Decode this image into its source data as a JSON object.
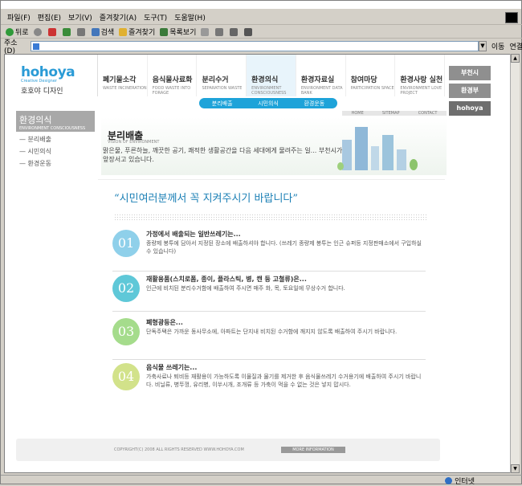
{
  "menubar": [
    "파일(F)",
    "편집(E)",
    "보기(V)",
    "즐겨찾기(A)",
    "도구(T)",
    "도움말(H)"
  ],
  "toolbar": {
    "back": "뒤로",
    "search": "검색",
    "favorites": "즐겨찾기",
    "history": "목록보기"
  },
  "address": {
    "label": "주소(D)",
    "value": "",
    "go": "이동",
    "links": "연결"
  },
  "status": {
    "text": "",
    "zone": "인터넷"
  },
  "site": {
    "logo": {
      "mark": "hohoya",
      "sub": "Creative Designer",
      "kr": "호호야 디자인"
    },
    "gnb": [
      {
        "t": "폐기물소각",
        "e": "WASTE INCINERATION"
      },
      {
        "t": "음식물사료화",
        "e": "FOOD WASTE INTO FORAGE"
      },
      {
        "t": "분리수거",
        "e": "SEPARATION WASTE"
      },
      {
        "t": "환경의식",
        "e": "ENVIRONMENT CONSCIOUSNESS"
      },
      {
        "t": "환경자료실",
        "e": "ENVIRONMENT DATA BANK"
      },
      {
        "t": "참여마당",
        "e": "PARTICIPATION SPACE"
      },
      {
        "t": "환경사랑 실천",
        "e": "ENVIRONMENT LOVE PROJECT"
      }
    ],
    "subnav": [
      "분리배출",
      "시민의식",
      "환경운동"
    ],
    "util": [
      "HOME",
      "SITEMAP",
      "CONTACT"
    ],
    "rightlinks": [
      "부천시",
      "환경부",
      "hohoya"
    ],
    "lnb": {
      "title": "환경의식",
      "sub": "ENVIRONMENT CONSCIOUSNESS",
      "items": [
        "분리배출",
        "시민의식",
        "환경운동"
      ]
    },
    "banner": {
      "title": "분리배출",
      "sub": "VISION OF ENVIRONMENT",
      "desc": "맑은물, 푸른하늘, 깨끗한 공기, 쾌적한 생활공간을 다음 세대에게 물려주는 일... 부천시가 앞장서고 있습니다."
    },
    "slogan": "“시민여러분께서 꼭 지켜주시기 바랍니다”",
    "steps": [
      {
        "num": "01",
        "h": "가정에서 배출되는 일반쓰레기는...",
        "p": "종량제 봉투에 담아서 지정된 장소에 배출하셔야 합니다. (쓰레기 종량제 봉투는 인근 슈퍼등 지정판매소에서 구입하실 수 있습니다)",
        "color": "#8fd0ea"
      },
      {
        "num": "02",
        "h": "재활용품(스치로폼, 종이, 플라스틱, 병, 캔 등 고철류)은...",
        "p": "인근에 비치된 분리수거함에 배출하여 주시면 매주 화, 목, 토요일에 무상수거 합니다.",
        "color": "#5fc8d8"
      },
      {
        "num": "03",
        "h": "폐형광등은...",
        "p": "단독주택은 가까운 동사무소에, 아파트는 단지내 비치된 수거함에 깨지지 않도록 배출하여 주시기 바랍니다.",
        "color": "#a5dc8c"
      },
      {
        "num": "04",
        "h": "음식물 쓰레기는...",
        "p": "가축사료나 퇴비등 재활용이 가능하도록 이물질과 물기를 제거한 후 음식물쓰레기 수거용기에 배출하여 주시기 바랍니다. 비닐류, 병뚜껑, 유리병, 이쑤시개, 조개류 등 가축이 먹을 수 없는 것은 넣지 맙시다.",
        "color": "#d2e28a"
      }
    ],
    "footer": {
      "copy": "COPYRIGHT(C) 2008 ALL RIGHTS RESERVED WWW.HOHOYA.COM",
      "more": "MORE INFORMATION"
    }
  }
}
